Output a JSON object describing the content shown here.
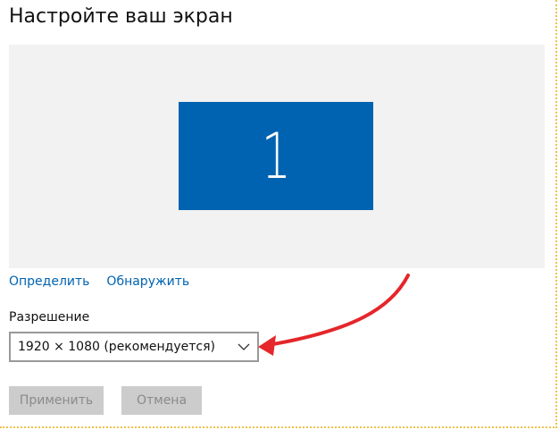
{
  "page": {
    "title": "Настройте ваш экран"
  },
  "display": {
    "monitor_number": "1",
    "tile_color": "#0063b1",
    "area_color": "#f2f2f2"
  },
  "links": {
    "identify": "Определить",
    "detect": "Обнаружить"
  },
  "resolution": {
    "label": "Разрешение",
    "value": "1920 × 1080 (рекомендуется)",
    "icon": "chevron-down-icon"
  },
  "buttons": {
    "apply": "Применить",
    "cancel": "Отмена"
  },
  "annotation": {
    "arrow_color": "#e5262a",
    "icon": "arrow-icon"
  }
}
